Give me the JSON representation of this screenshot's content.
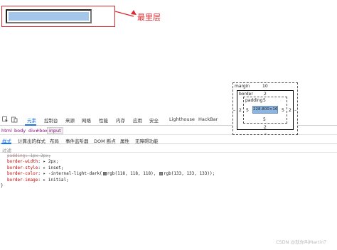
{
  "annotation": {
    "label": "最里层"
  },
  "devtools": {
    "tabs": [
      "元素",
      "控制台",
      "来源",
      "网络",
      "性能",
      "内存",
      "应用",
      "安全",
      "Lighthouse",
      "HackBar"
    ],
    "active_tab": "元素",
    "breadcrumb": [
      "html",
      "body",
      "div#box",
      "input"
    ],
    "subtabs": [
      "样式",
      "计算出的样式",
      "布局",
      "事件监听器",
      "DOM 断点",
      "属性",
      "无障碍功能"
    ],
    "filter_placeholder": "过滤",
    "styles": {
      "padding_prop": "padding",
      "padding_val": "1px 2px;",
      "border_width_prop": "border-width",
      "border_width_val": "2px;",
      "border_style_prop": "border-style",
      "border_style_val": "inset;",
      "border_color_prop": "border-color",
      "border_color_val_a": "-internal-light-dark(",
      "border_color_val_b": "rgb(118, 118, 118),",
      "border_color_val_c": "rgb(133, 133, 133));",
      "border_image_prop": "border-image",
      "border_image_val": "initial;",
      "close_brace": "}",
      "swatch_colors": [
        "#767676",
        "#858585"
      ]
    },
    "box_model": {
      "margin_label": "margin",
      "margin_top": "10",
      "margin_left": "–",
      "margin_right": "–",
      "margin_bottom": "–",
      "border_label": "border",
      "border_top": "2",
      "border_left": "2",
      "border_right": "2",
      "border_bottom": "2",
      "padding_label": "padding",
      "padding_top": "5",
      "padding_left": "5",
      "padding_right": "5",
      "padding_bottom": "5",
      "content": "228.800×16"
    }
  },
  "watermark": "CSDN @就你叫Martin？",
  "colors": {
    "accent": "#1a73e8",
    "annotation": "#e0262d",
    "content_fill": "#8cb6e1"
  }
}
